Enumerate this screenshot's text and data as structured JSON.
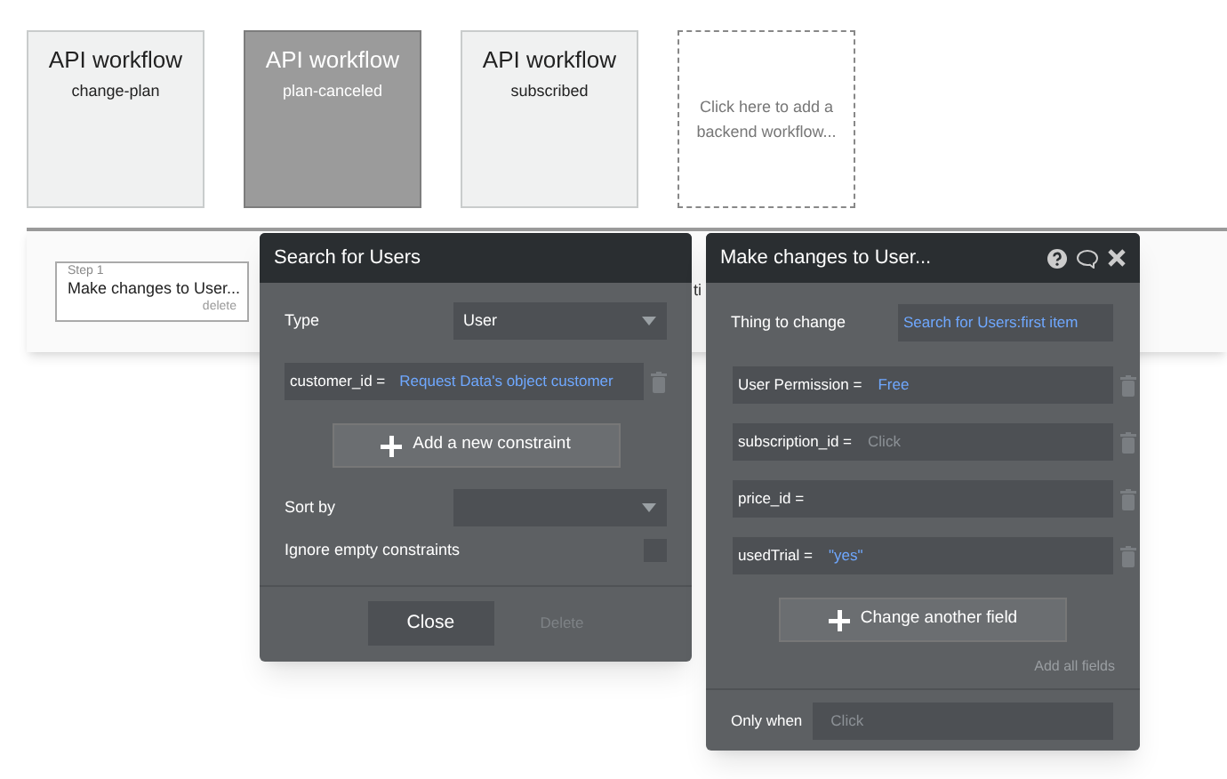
{
  "workflows": [
    {
      "title": "API workflow",
      "name": "change-plan",
      "selected": false
    },
    {
      "title": "API workflow",
      "name": "plan-canceled",
      "selected": true
    },
    {
      "title": "API workflow",
      "name": "subscribed",
      "selected": false
    }
  ],
  "add_workflow": "Click here to add a backend workflow...",
  "step": {
    "label": "Step 1",
    "title": "Make changes to User...",
    "delete": "delete"
  },
  "partial_label": "ti",
  "search_panel": {
    "title": "Search for Users",
    "type_label": "Type",
    "type_value": "User",
    "constraints": [
      {
        "field": "customer_id =",
        "value": "Request Data's object customer"
      }
    ],
    "add_button": "Add a new constraint",
    "sort_label": "Sort by",
    "ignore_label": "Ignore empty constraints",
    "ignore_checked": false,
    "close": "Close",
    "delete": {
      "label": "Delete",
      "disabled": true
    }
  },
  "changes_panel": {
    "title": "Make changes to User...",
    "thing_label": "Thing to change",
    "thing_value": "Search for Users:first item",
    "fields": [
      {
        "name": "User Permission =",
        "value": "Free",
        "kind": "value"
      },
      {
        "name": "subscription_id =",
        "value": "Click",
        "kind": "placeholder"
      },
      {
        "name": "price_id =",
        "kind": "empty"
      },
      {
        "name": "usedTrial =",
        "value": "\"yes\"",
        "kind": "value"
      }
    ],
    "add_button": "Change another field",
    "add_all": "Add all fields",
    "only_when_label": "Only when",
    "only_when_placeholder": "Click"
  }
}
